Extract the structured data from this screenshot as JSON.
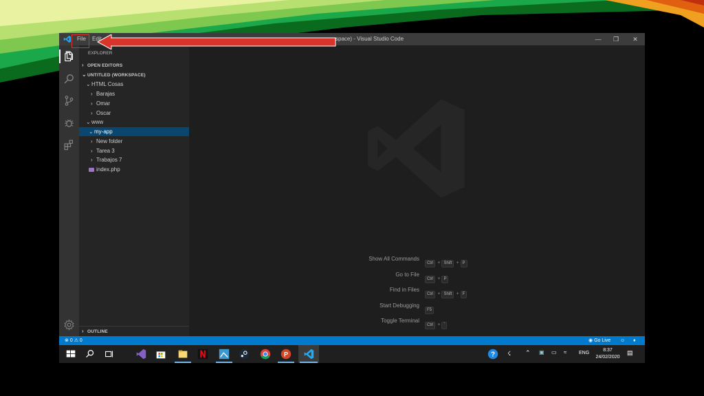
{
  "titlebar": {
    "menu": [
      "File",
      "Edit"
    ],
    "title": "space) - Visual Studio Code"
  },
  "sidebar": {
    "explorer_title": "EXPLORER",
    "open_editors": "OPEN EDITORS",
    "workspace": "UNTITLED (WORKSPACE)",
    "items": [
      {
        "label": "HTML Cosas",
        "expanded": true
      },
      {
        "label": "Barajas"
      },
      {
        "label": "Omar"
      },
      {
        "label": "Oscar"
      },
      {
        "label": "www",
        "expanded": true
      },
      {
        "label": "my-app",
        "selected": true,
        "expanded": true
      },
      {
        "label": "New folder"
      },
      {
        "label": "Tarea 3"
      },
      {
        "label": "Trabajos 7"
      },
      {
        "label": "index.php",
        "icon": "php-icon"
      }
    ],
    "outline": "OUTLINE"
  },
  "editor": {
    "commands": [
      {
        "label": "Show All Commands",
        "keys": [
          "Ctrl",
          "Shift",
          "P"
        ]
      },
      {
        "label": "Go to File",
        "keys": [
          "Ctrl",
          "P"
        ]
      },
      {
        "label": "Find in Files",
        "keys": [
          "Ctrl",
          "Shift",
          "F"
        ]
      },
      {
        "label": "Start Debugging",
        "keys": [
          "F5"
        ]
      },
      {
        "label": "Toggle Terminal",
        "keys": [
          "Ctrl",
          "`"
        ]
      }
    ]
  },
  "statusbar": {
    "problems": "0",
    "warnings": "0",
    "golive": "Go Live"
  },
  "taskbar": {
    "language": "ENG",
    "time": "8:37",
    "date": "24/02/2020"
  },
  "colors": {
    "accent": "#007acc",
    "annotation": "#d9342b"
  }
}
